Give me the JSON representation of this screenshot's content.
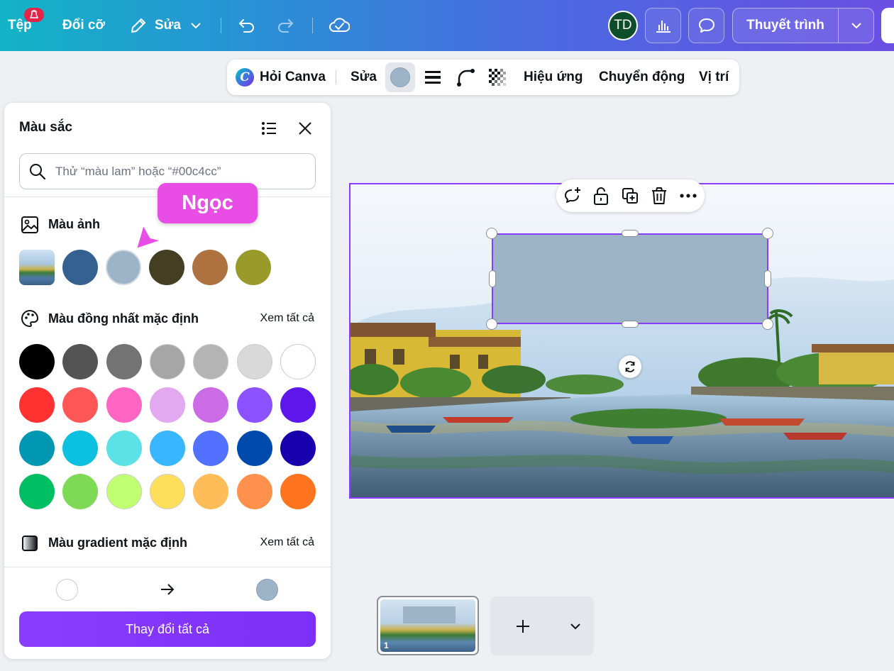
{
  "topbar": {
    "file_label": "Tệp",
    "resize_label": "Đổi cỡ",
    "edit_label": "Sửa",
    "avatar_initials": "TD",
    "present_label": "Thuyết trình"
  },
  "context_toolbar": {
    "ask_canva_label": "Hỏi Canva",
    "edit_label": "Sửa",
    "current_fill_color": "#9cb3c8",
    "effects_label": "Hiệu ứng",
    "animate_label": "Chuyển động",
    "position_label": "Vị trí"
  },
  "color_panel": {
    "title": "Màu sắc",
    "search_placeholder": "Thử “màu lam” hoặc “#00c4cc”",
    "photo_colors": {
      "title": "Màu ảnh",
      "swatches": [
        "#34618f",
        "#9cb3c8",
        "#443f22",
        "#ad7240",
        "#9a9a2a"
      ]
    },
    "default_solid": {
      "title": "Màu đồng nhất mặc định",
      "see_all": "Xem tất cả",
      "rows": [
        [
          "#000000",
          "#545454",
          "#737373",
          "#a6a6a6",
          "#b4b4b4",
          "#d9d9d9",
          "#ffffff"
        ],
        [
          "#ff3131",
          "#ff5757",
          "#ff66c4",
          "#e2a9f1",
          "#cb6ce6",
          "#8c52ff",
          "#5e17eb"
        ],
        [
          "#0097b2",
          "#0cc0df",
          "#5ce1e6",
          "#38b6ff",
          "#5271ff",
          "#004aad",
          "#1800ad"
        ],
        [
          "#00bf63",
          "#7ed957",
          "#c1ff72",
          "#ffde59",
          "#ffbd59",
          "#ff914d",
          "#ff751f"
        ]
      ]
    },
    "default_gradient": {
      "title": "Màu gradient mặc định",
      "see_all": "Xem tất cả"
    },
    "replace": {
      "from_color": "#ffffff",
      "to_color": "#9cb3c8",
      "button_label": "Thay đổi tất cả"
    }
  },
  "collaborator_tag": "Ngọc",
  "pages": {
    "current_page_number": "1"
  },
  "colors": {
    "accent": "#8b3dff",
    "tag": "#e84ee6"
  }
}
